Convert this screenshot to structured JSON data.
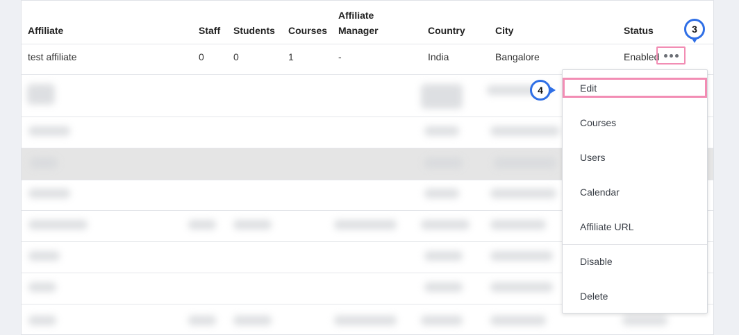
{
  "table": {
    "headers": {
      "affiliate": "Affiliate",
      "staff": "Staff",
      "students": "Students",
      "courses": "Courses",
      "manager_line1": "Affiliate",
      "manager_line2": "Manager",
      "country": "Country",
      "city": "City",
      "status": "Status"
    },
    "row": {
      "affiliate": "test affiliate",
      "staff": "0",
      "students": "0",
      "courses": "1",
      "manager": "-",
      "country": "India",
      "city": "Bangalore",
      "status": "Enabled"
    },
    "actions_icon": "ellipsis-icon"
  },
  "dropdown": {
    "items": [
      "Edit",
      "Courses",
      "Users",
      "Calendar",
      "Affiliate URL",
      "Disable",
      "Delete"
    ]
  },
  "callouts": {
    "step3": "3",
    "step4": "4"
  },
  "colors": {
    "highlight": "#f28db4",
    "callout": "#2f6fe6"
  }
}
